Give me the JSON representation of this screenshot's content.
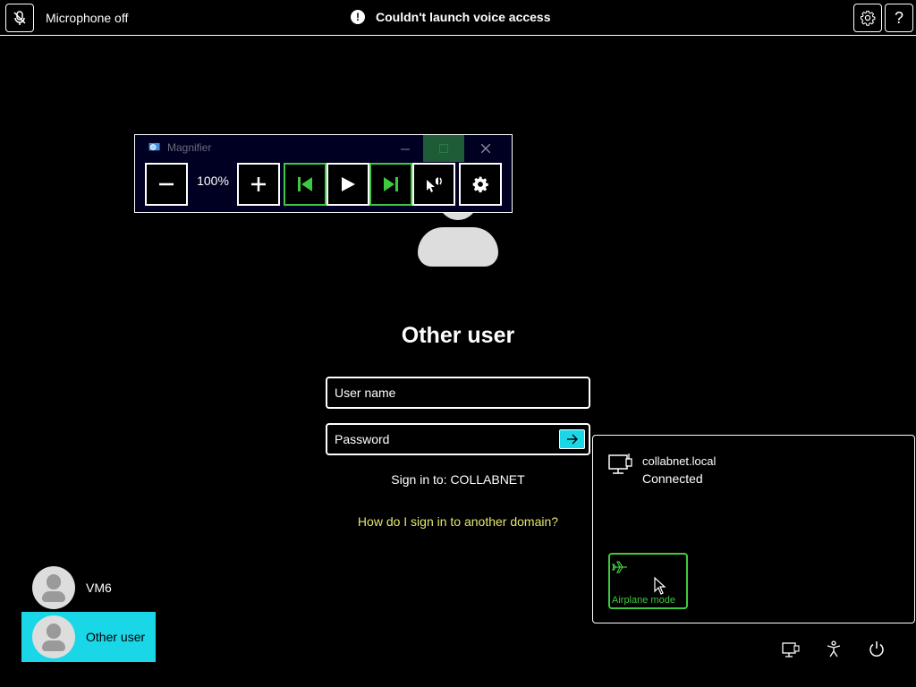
{
  "topbar": {
    "mic_label": "Microphone off",
    "notice_text": "Couldn't launch voice access",
    "help_label": "?"
  },
  "magnifier": {
    "title": "Magnifier",
    "zoom": "100%"
  },
  "signin": {
    "title": "Other user",
    "username_placeholder": "User name",
    "password_placeholder": "Password",
    "sign_in_to": "Sign in to: COLLABNET",
    "domain_link": "How do I sign in to another domain?"
  },
  "users": [
    {
      "name": "VM6"
    },
    {
      "name": "Other user"
    }
  ],
  "network": {
    "name": "collabnet.local",
    "status": "Connected",
    "airplane_label": "Airplane mode"
  },
  "colors": {
    "accent": "#1ad7e8",
    "link": "#e6e66d",
    "highlight": "#3ec93e"
  },
  "icons": [
    "microphone-off-icon",
    "warning-icon",
    "gear-icon",
    "help-icon",
    "network-icon",
    "airplane-icon",
    "accessibility-icon",
    "power-icon"
  ]
}
